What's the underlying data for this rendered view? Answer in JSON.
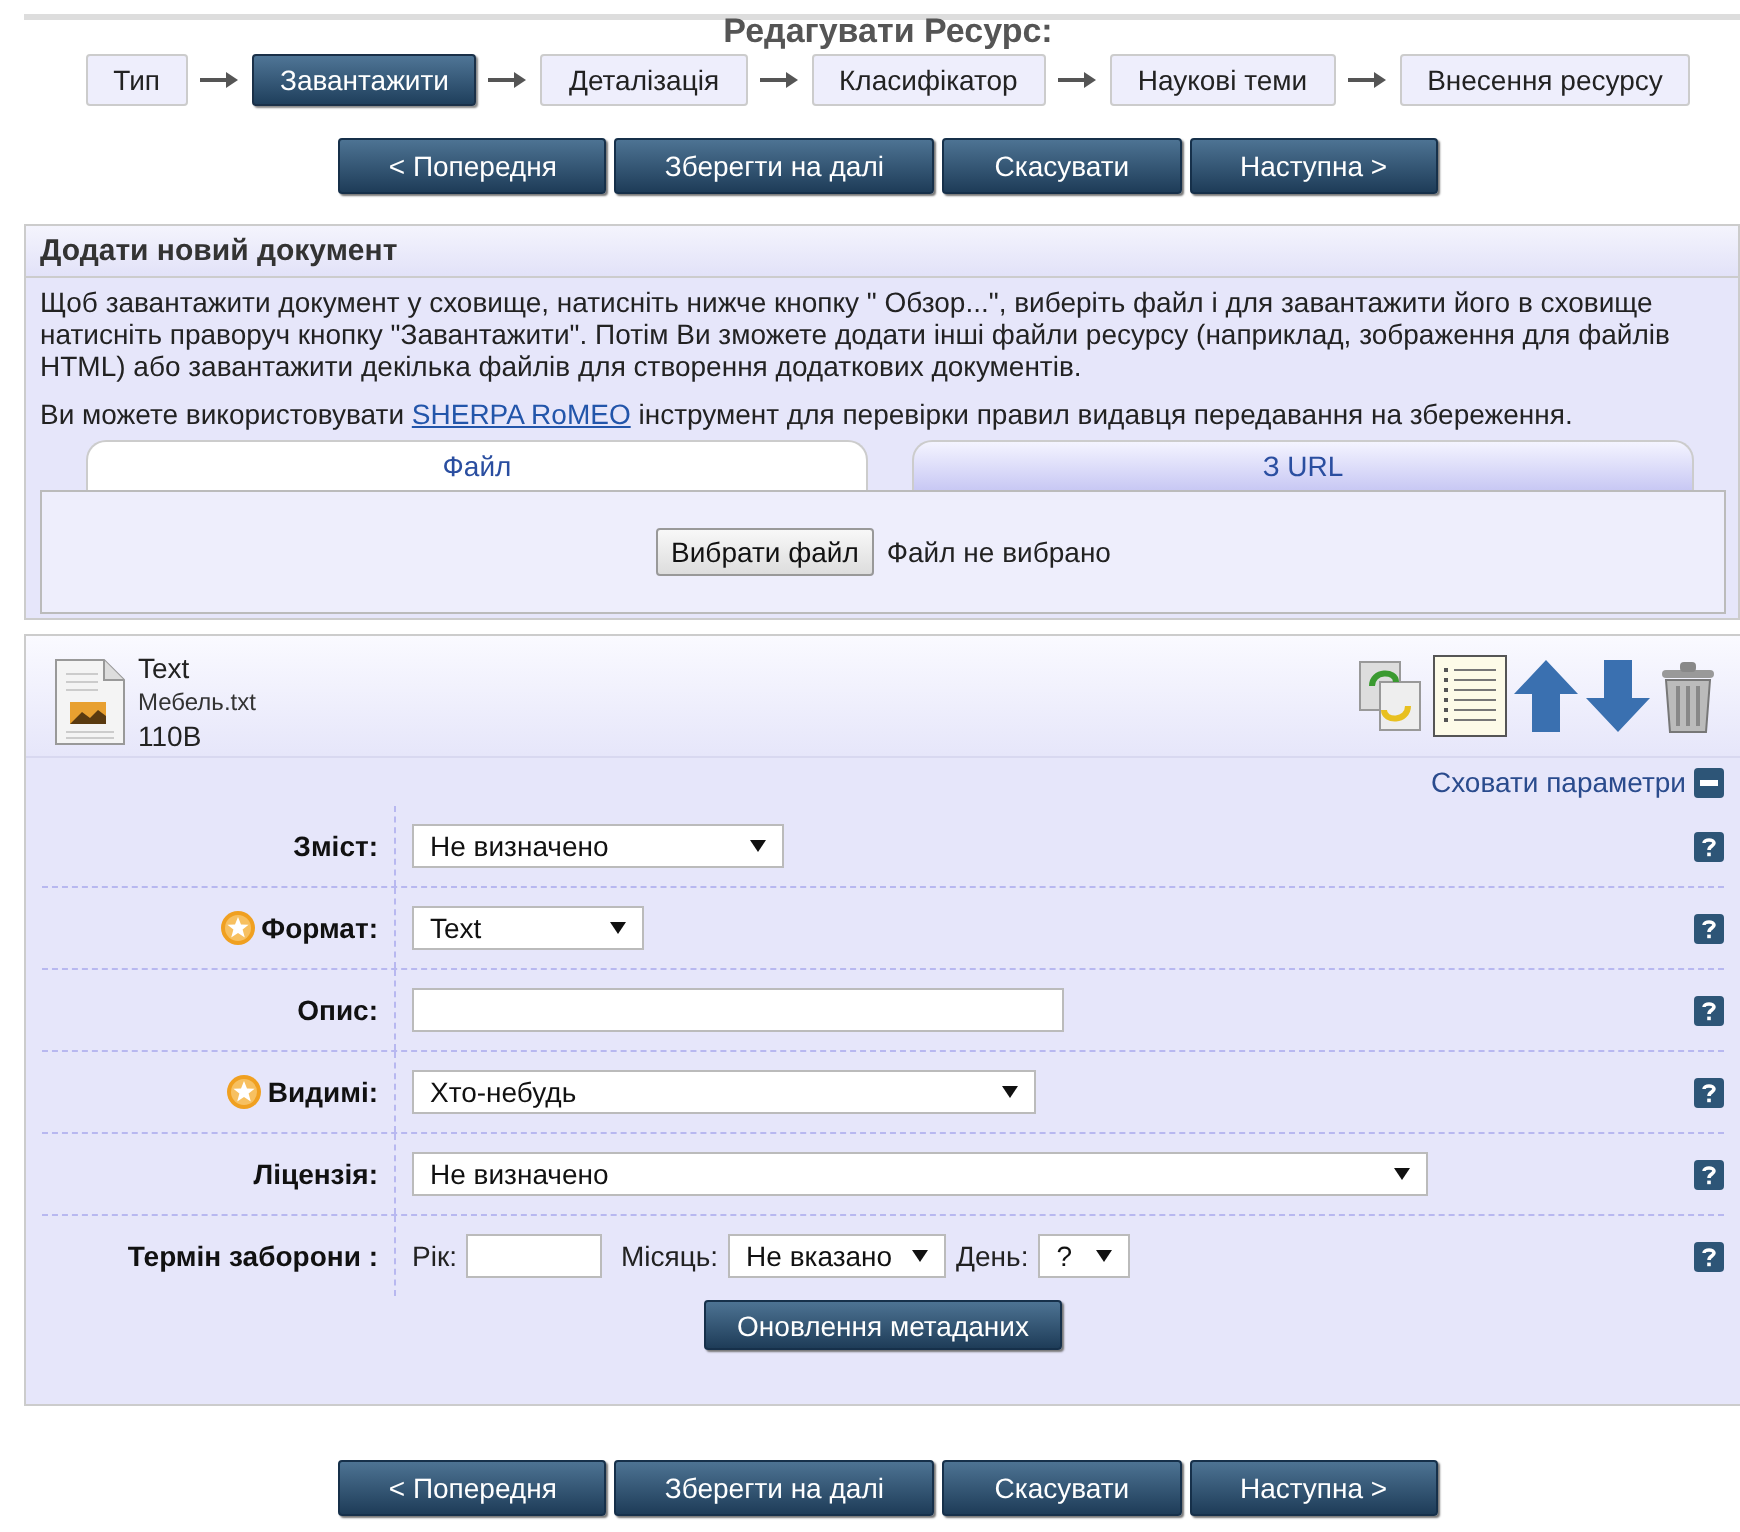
{
  "page_title": "Редагувати Ресурс:",
  "stages": [
    {
      "label": "Тип",
      "selected": false
    },
    {
      "label": "Завантажити",
      "selected": true
    },
    {
      "label": "Деталізація",
      "selected": false
    },
    {
      "label": "Класифікатор",
      "selected": false
    },
    {
      "label": "Наукові теми",
      "selected": false
    },
    {
      "label": "Внесення ресурсу",
      "selected": false
    }
  ],
  "nav_buttons": [
    "< Попередня",
    "Зберегти на далі",
    "Скасувати",
    "Наступна >"
  ],
  "upload": {
    "heading": "Додати новий документ",
    "intro": "Щоб завантажити документ у сховище, натисніть нижче кнопку \" Обзор...\", виберіть файл і для завантажити його в сховище натисніть праворуч кнопку \"Завантажити\". Потім Ви зможете додати інші файли ресурсу (наприклад, зображення для файлів HTML) або завантажити декілька файлів для створення додаткових документів.",
    "note_before": "Ви можете використовувати ",
    "link": "SHERPA RoMEO",
    "note_after": " інструмент для перевірки правил видавця передавання на збереження.",
    "tabs": [
      {
        "label": "Файл",
        "selected": true
      },
      {
        "label": "З URL",
        "selected": false
      }
    ],
    "choose_button": "Вибрати файл",
    "file_status": "Файл не вибрано"
  },
  "document": {
    "type": "Text",
    "filename": "Мебель.txt",
    "size": "110B",
    "toggle": "Сховати параметри",
    "fields": [
      {
        "kind": "select",
        "label": "Зміст:",
        "required": false,
        "value": "Не визначено"
      },
      {
        "kind": "select",
        "label": "Формат:",
        "required": true,
        "value": "Text"
      },
      {
        "kind": "text",
        "label": "Опис:",
        "required": false
      },
      {
        "kind": "select",
        "label": "Видимі:",
        "required": true,
        "value": "Хто-небудь"
      },
      {
        "kind": "select",
        "label": "Ліцензія:",
        "required": false,
        "value": "Не визначено"
      },
      {
        "kind": "embargo",
        "label": "Термін заборони :",
        "required": false,
        "year_label": "Рік:",
        "month_label": "Місяць:",
        "month_value": "Не вказано",
        "day_label": "День:",
        "day_value": "?"
      }
    ],
    "update_button": "Оновлення метаданих"
  },
  "bottom_nav_buttons": [
    "< Попередня",
    "Зберегти на далі",
    "Скасувати",
    "Наступна >"
  ]
}
